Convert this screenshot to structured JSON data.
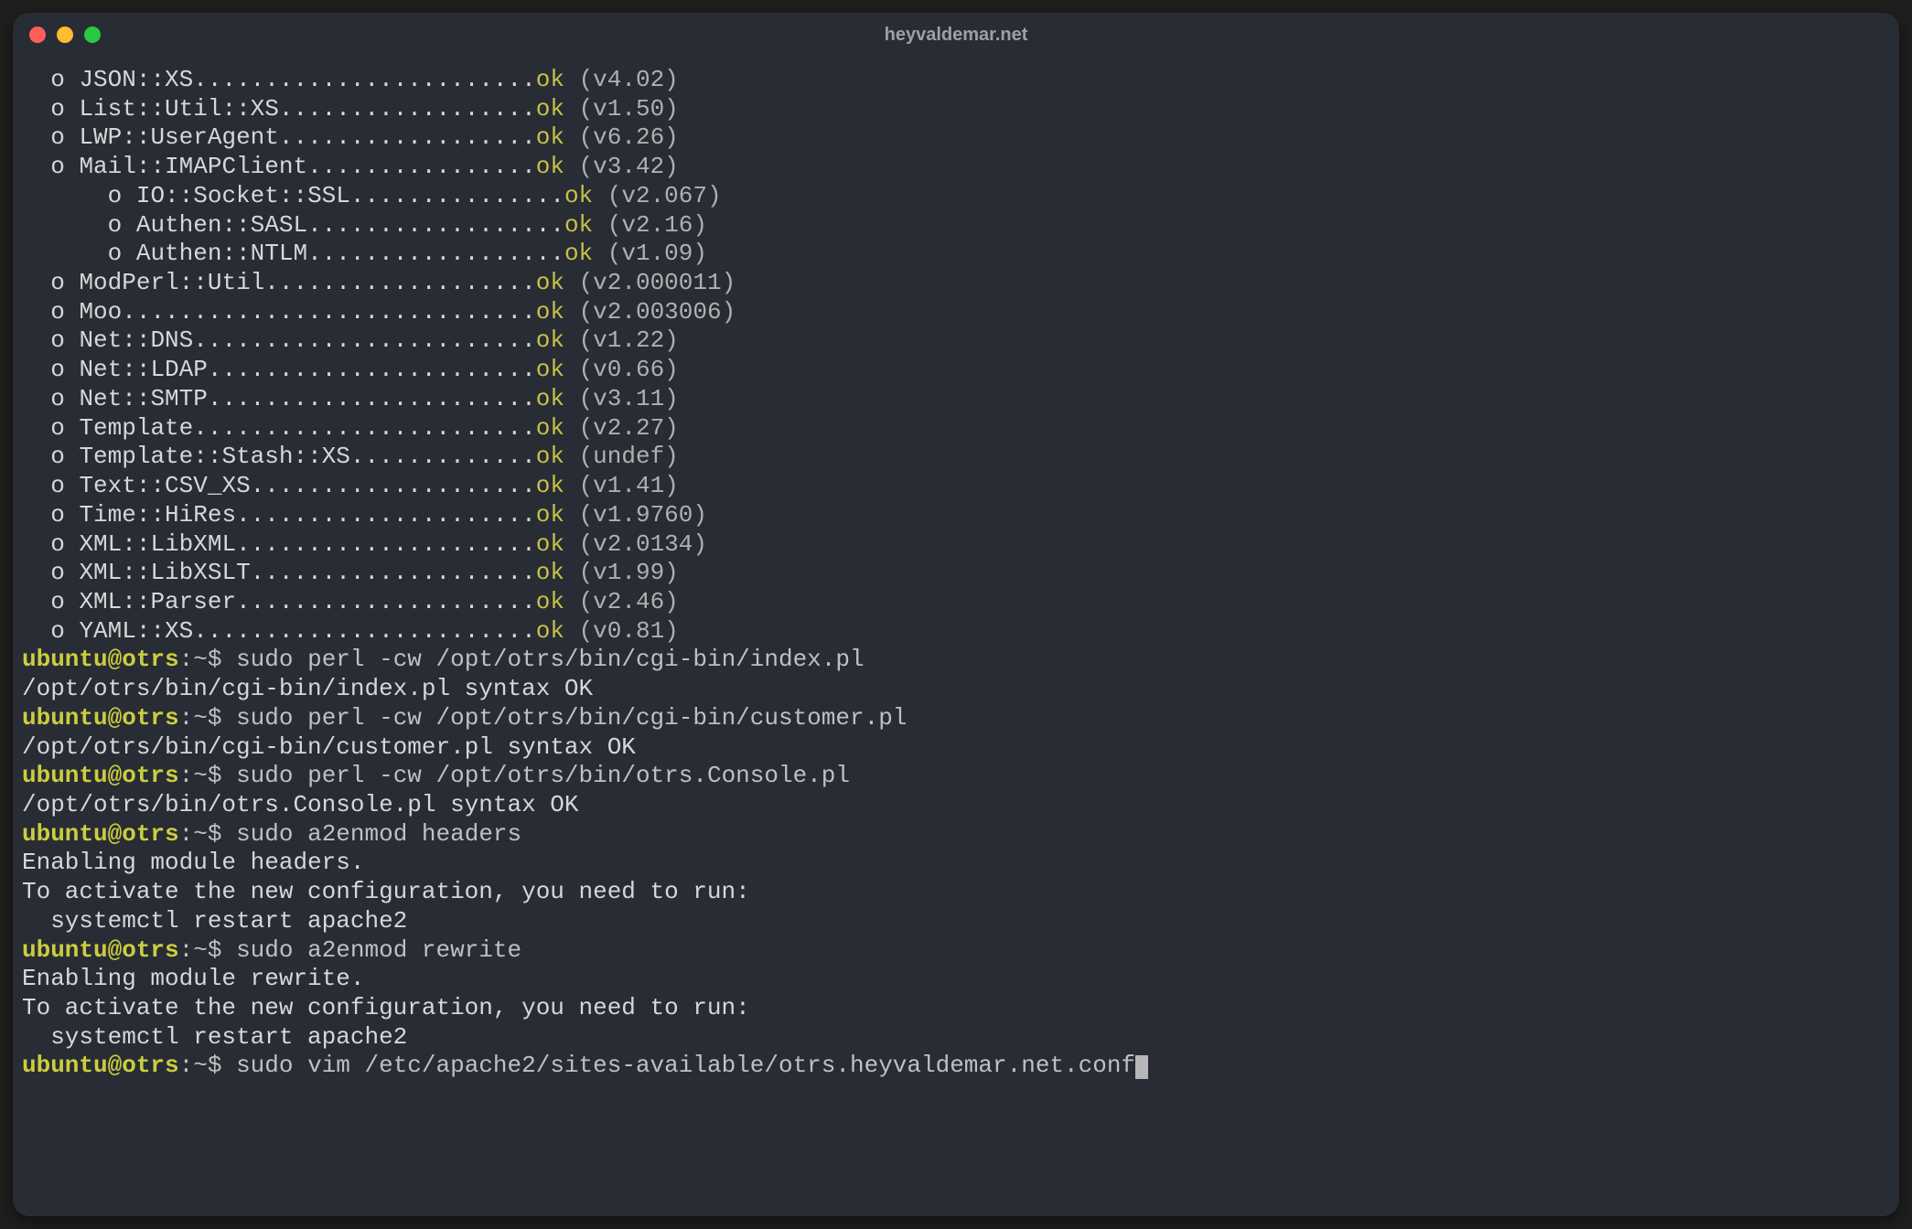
{
  "window_title": "heyvaldemar.net",
  "prompt_user": "ubuntu",
  "prompt_host": "otrs",
  "prompt_path": "~",
  "prompt_symbol": "$",
  "modules": [
    {
      "indent": 0,
      "name": "JSON::XS",
      "dots": "........................",
      "version": "(v4.02)"
    },
    {
      "indent": 0,
      "name": "List::Util::XS",
      "dots": "..................",
      "version": "(v1.50)"
    },
    {
      "indent": 0,
      "name": "LWP::UserAgent",
      "dots": "..................",
      "version": "(v6.26)"
    },
    {
      "indent": 0,
      "name": "Mail::IMAPClient",
      "dots": "................",
      "version": "(v3.42)"
    },
    {
      "indent": 2,
      "name": "IO::Socket::SSL",
      "dots": "...............",
      "version": "(v2.067)"
    },
    {
      "indent": 2,
      "name": "Authen::SASL",
      "dots": "..................",
      "version": "(v2.16)"
    },
    {
      "indent": 2,
      "name": "Authen::NTLM",
      "dots": "..................",
      "version": "(v1.09)"
    },
    {
      "indent": 0,
      "name": "ModPerl::Util",
      "dots": "...................",
      "version": "(v2.000011)"
    },
    {
      "indent": 0,
      "name": "Moo",
      "dots": ".............................",
      "version": "(v2.003006)"
    },
    {
      "indent": 0,
      "name": "Net::DNS",
      "dots": "........................",
      "version": "(v1.22)"
    },
    {
      "indent": 0,
      "name": "Net::LDAP",
      "dots": ".......................",
      "version": "(v0.66)"
    },
    {
      "indent": 0,
      "name": "Net::SMTP",
      "dots": ".......................",
      "version": "(v3.11)"
    },
    {
      "indent": 0,
      "name": "Template",
      "dots": "........................",
      "version": "(v2.27)"
    },
    {
      "indent": 0,
      "name": "Template::Stash::XS",
      "dots": ".............",
      "version": "(undef)"
    },
    {
      "indent": 0,
      "name": "Text::CSV_XS",
      "dots": "....................",
      "version": "(v1.41)"
    },
    {
      "indent": 0,
      "name": "Time::HiRes",
      "dots": ".....................",
      "version": "(v1.9760)"
    },
    {
      "indent": 0,
      "name": "XML::LibXML",
      "dots": ".....................",
      "version": "(v2.0134)"
    },
    {
      "indent": 0,
      "name": "XML::LibXSLT",
      "dots": "....................",
      "version": "(v1.99)"
    },
    {
      "indent": 0,
      "name": "XML::Parser",
      "dots": ".....................",
      "version": "(v2.46)"
    },
    {
      "indent": 0,
      "name": "YAML::XS",
      "dots": "........................",
      "version": "(v0.81)"
    }
  ],
  "lines": [
    {
      "type": "prompt",
      "cmd": "sudo perl -cw /opt/otrs/bin/cgi-bin/index.pl"
    },
    {
      "type": "out",
      "text": "/opt/otrs/bin/cgi-bin/index.pl syntax OK"
    },
    {
      "type": "prompt",
      "cmd": "sudo perl -cw /opt/otrs/bin/cgi-bin/customer.pl"
    },
    {
      "type": "out",
      "text": "/opt/otrs/bin/cgi-bin/customer.pl syntax OK"
    },
    {
      "type": "prompt",
      "cmd": "sudo perl -cw /opt/otrs/bin/otrs.Console.pl"
    },
    {
      "type": "out",
      "text": "/opt/otrs/bin/otrs.Console.pl syntax OK"
    },
    {
      "type": "prompt",
      "cmd": "sudo a2enmod headers"
    },
    {
      "type": "out",
      "text": "Enabling module headers."
    },
    {
      "type": "out",
      "text": "To activate the new configuration, you need to run:"
    },
    {
      "type": "out",
      "text": "  systemctl restart apache2"
    },
    {
      "type": "prompt",
      "cmd": "sudo a2enmod rewrite"
    },
    {
      "type": "out",
      "text": "Enabling module rewrite."
    },
    {
      "type": "out",
      "text": "To activate the new configuration, you need to run:"
    },
    {
      "type": "out",
      "text": "  systemctl restart apache2"
    },
    {
      "type": "prompt_cursor",
      "cmd": "sudo vim /etc/apache2/sites-available/otrs.heyvaldemar.net.conf"
    }
  ],
  "ok_text": "ok",
  "bullet": "o"
}
